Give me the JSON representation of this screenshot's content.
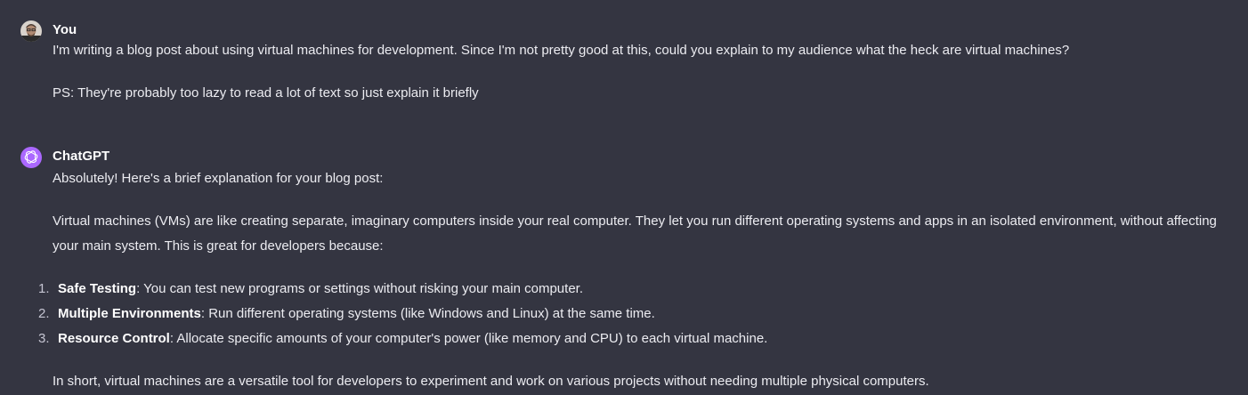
{
  "user": {
    "author": "You",
    "paragraphs": [
      "I'm writing a blog post about using virtual machines for development. Since I'm not pretty good at this, could you explain to my audience what the heck are virtual machines?",
      "PS: They're probably too lazy to read a lot of text so just explain it briefly"
    ]
  },
  "assistant": {
    "author": "ChatGPT",
    "intro": "Absolutely! Here's a brief explanation for your blog post:",
    "body": "Virtual machines (VMs) are like creating separate, imaginary computers inside your real computer. They let you run different operating systems and apps in an isolated environment, without affecting your main system. This is great for developers because:",
    "list": [
      {
        "num": "1.",
        "title": "Safe Testing",
        "text": ": You can test new programs or settings without risking your main computer."
      },
      {
        "num": "2.",
        "title": "Multiple Environments",
        "text": ": Run different operating systems (like Windows and Linux) at the same time."
      },
      {
        "num": "3.",
        "title": "Resource Control",
        "text": ": Allocate specific amounts of your computer's power (like memory and CPU) to each virtual machine."
      }
    ],
    "conclusion": "In short, virtual machines are a versatile tool for developers to experiment and work on various projects without needing multiple physical computers."
  },
  "colors": {
    "background": "#343541",
    "text": "#ececf1",
    "assistant_avatar": "#ab68ff"
  }
}
